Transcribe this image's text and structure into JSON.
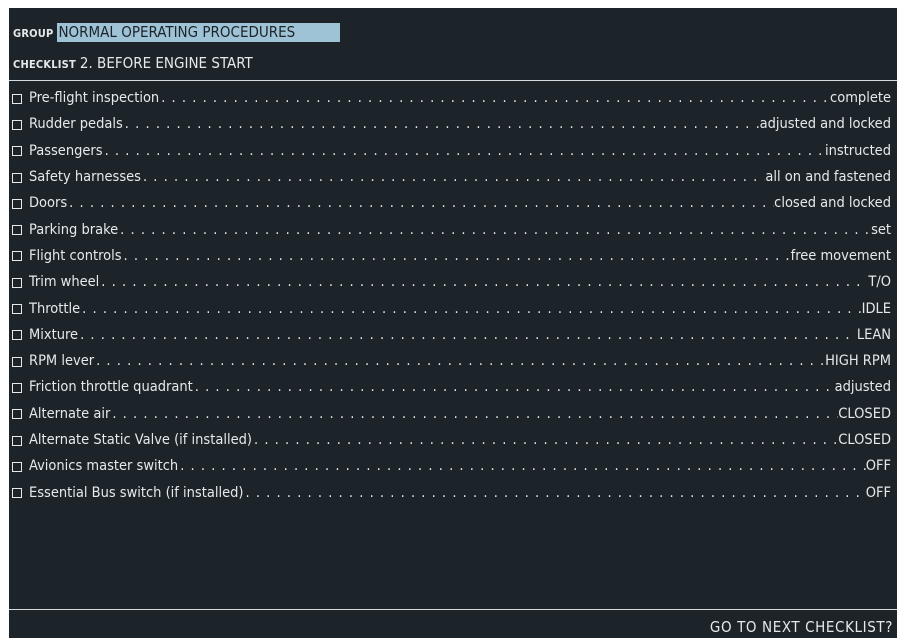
{
  "header": {
    "group_label": "GROUP",
    "group_value": "NORMAL OPERATING PROCEDURES",
    "checklist_label": "CHECKLIST",
    "checklist_value": "2. BEFORE ENGINE START"
  },
  "items": [
    {
      "label": "Pre-flight inspection",
      "action": "complete"
    },
    {
      "label": "Rudder pedals",
      "action": "adjusted and locked"
    },
    {
      "label": "Passengers",
      "action": "instructed"
    },
    {
      "label": "Safety harnesses",
      "action": "all on and fastened"
    },
    {
      "label": "Doors",
      "action": "closed and locked"
    },
    {
      "label": "Parking brake",
      "action": "set"
    },
    {
      "label": "Flight controls",
      "action": "free movement"
    },
    {
      "label": "Trim wheel",
      "action": "T/O"
    },
    {
      "label": "Throttle",
      "action": "IDLE"
    },
    {
      "label": "Mixture",
      "action": "LEAN"
    },
    {
      "label": "RPM lever",
      "action": "HIGH RPM"
    },
    {
      "label": "Friction throttle quadrant",
      "action": "adjusted"
    },
    {
      "label": "Alternate air",
      "action": "CLOSED"
    },
    {
      "label": "Alternate Static Valve (if installed)",
      "action": "CLOSED"
    },
    {
      "label": "Avionics master switch",
      "action": "OFF"
    },
    {
      "label": "Essential Bus switch (if installed)",
      "action": "OFF"
    }
  ],
  "footer": {
    "next_label": "GO TO NEXT CHECKLIST?"
  },
  "colors": {
    "background": "#1c2429",
    "text": "#e6e9eb",
    "selection_highlight": "#9fc3d6"
  }
}
